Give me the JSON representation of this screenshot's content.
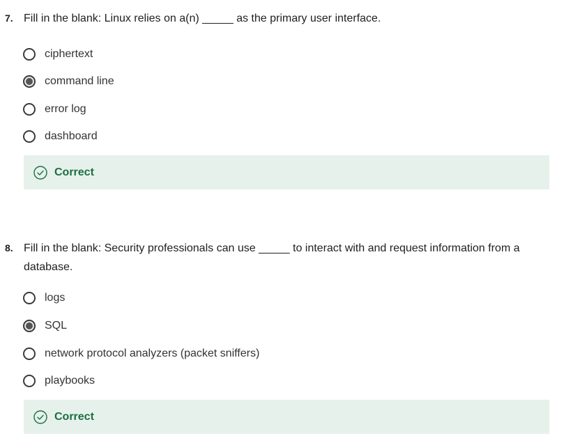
{
  "questions": [
    {
      "number": "7.",
      "text": "Fill in the blank: Linux relies on a(n) _____ as the primary user interface.",
      "options": [
        {
          "label": "ciphertext",
          "selected": false
        },
        {
          "label": "command line",
          "selected": true
        },
        {
          "label": "error log",
          "selected": false
        },
        {
          "label": "dashboard",
          "selected": false
        }
      ],
      "feedback": "Correct"
    },
    {
      "number": "8.",
      "text": "Fill in the blank: Security professionals can use _____ to interact with and request information from a database.",
      "options": [
        {
          "label": "logs",
          "selected": false
        },
        {
          "label": "SQL",
          "selected": true
        },
        {
          "label": "network protocol analyzers (packet sniffers)",
          "selected": false
        },
        {
          "label": "playbooks",
          "selected": false
        }
      ],
      "feedback": "Correct"
    }
  ],
  "colors": {
    "feedback_bg": "#e6f1ec",
    "feedback_text": "#1d6e42",
    "radio_border": "#3a3a3a"
  }
}
